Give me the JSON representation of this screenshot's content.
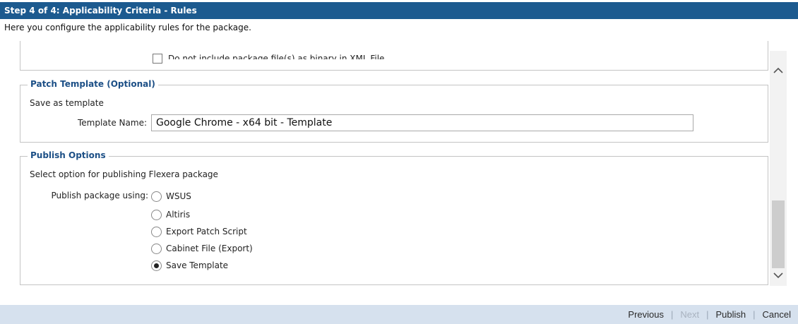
{
  "header": {
    "title": "Step 4 of 4: Applicability Criteria - Rules",
    "subtitle": "Here you configure the applicability rules for the package."
  },
  "top_section": {
    "checkbox_label": "Do not include package file(s) as binary in XML File.",
    "checked": false
  },
  "patch_template": {
    "legend": "Patch Template (Optional)",
    "description": "Save as template",
    "template_name_label": "Template Name:",
    "template_name_value": "Google Chrome - x64 bit - Template"
  },
  "publish_options": {
    "legend": "Publish Options",
    "description": "Select option for publishing Flexera package",
    "publish_label": "Publish package using:",
    "options": [
      {
        "label": "WSUS",
        "selected": false
      },
      {
        "label": "Altiris",
        "selected": false
      },
      {
        "label": "Export Patch Script",
        "selected": false
      },
      {
        "label": "Cabinet File (Export)",
        "selected": false
      },
      {
        "label": "Save Template",
        "selected": true
      }
    ]
  },
  "footer": {
    "previous": "Previous",
    "next": "Next",
    "publish": "Publish",
    "cancel": "Cancel"
  },
  "colors": {
    "title_bar": "#1c5a8f",
    "legend_text": "#1c4f86",
    "footer_bg": "#d6e1ee"
  }
}
